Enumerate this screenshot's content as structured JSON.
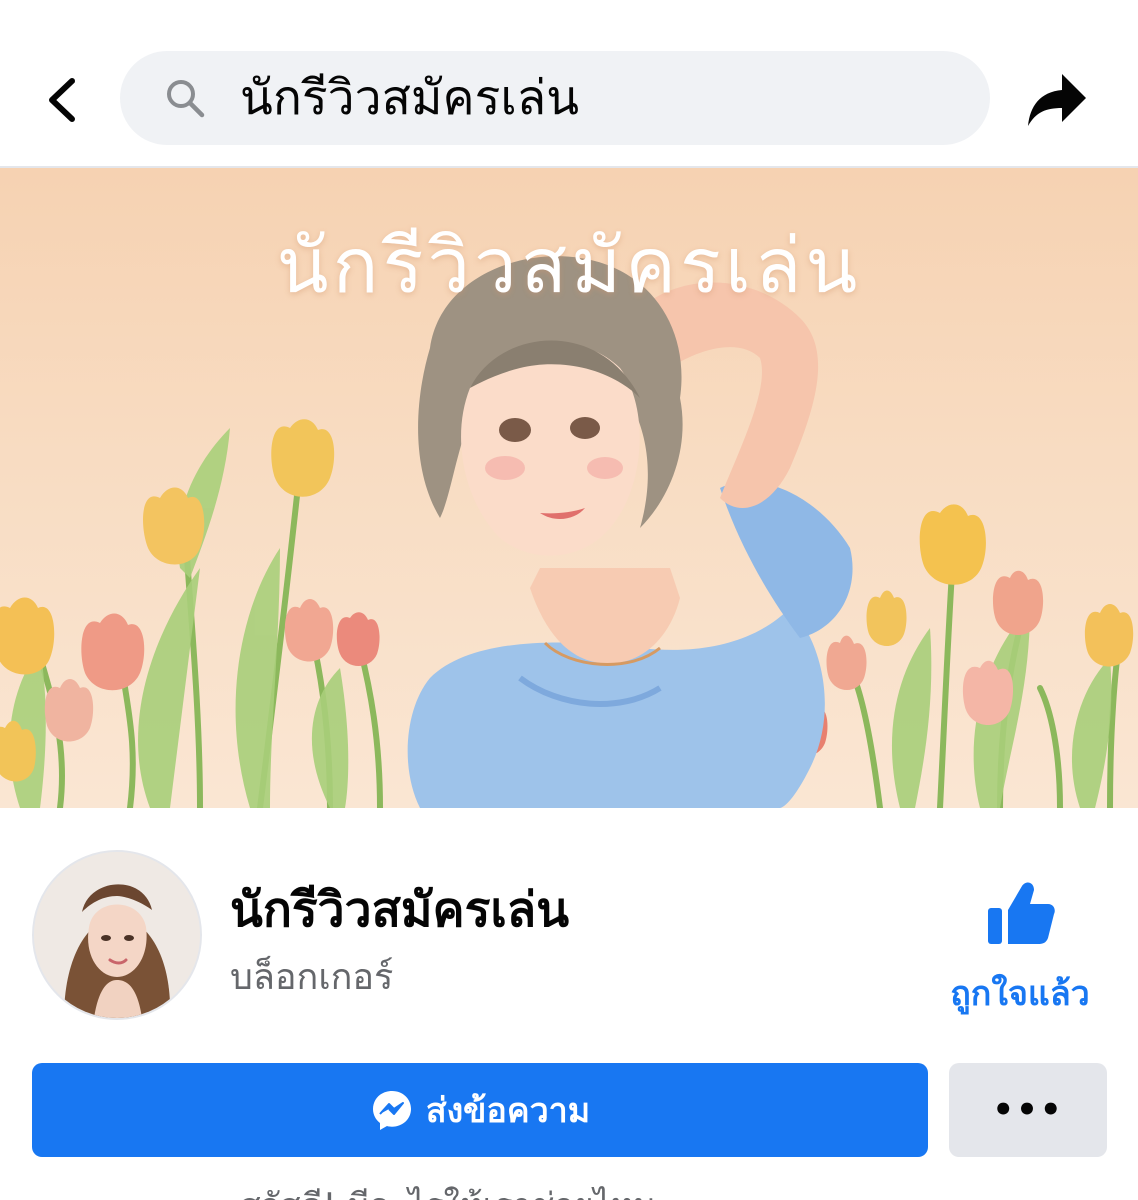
{
  "search": {
    "query": "นักรีวิวสมัครเล่น"
  },
  "icons": {
    "back": "back-chevron-icon",
    "search": "search-icon",
    "share": "share-arrow-icon",
    "like": "thumbs-up-icon",
    "messenger": "messenger-icon",
    "more": "more-dots-icon"
  },
  "cover": {
    "title": "นักรีวิวสมัครเล่น"
  },
  "profile": {
    "name": "นักรีวิวสมัครเล่น",
    "category": "บล็อกเกอร์"
  },
  "like_button": {
    "label": "ถูกใจแล้ว"
  },
  "actions": {
    "message_label": "ส่งข้อความ",
    "more_label": "•••"
  },
  "greeting": "สวัสดี! มีอะไรให้เราช่วยไหม",
  "colors": {
    "accent": "#1877f2",
    "search_bg": "#f0f2f5",
    "secondary_btn": "#e4e6eb",
    "muted_text": "#65676b"
  }
}
